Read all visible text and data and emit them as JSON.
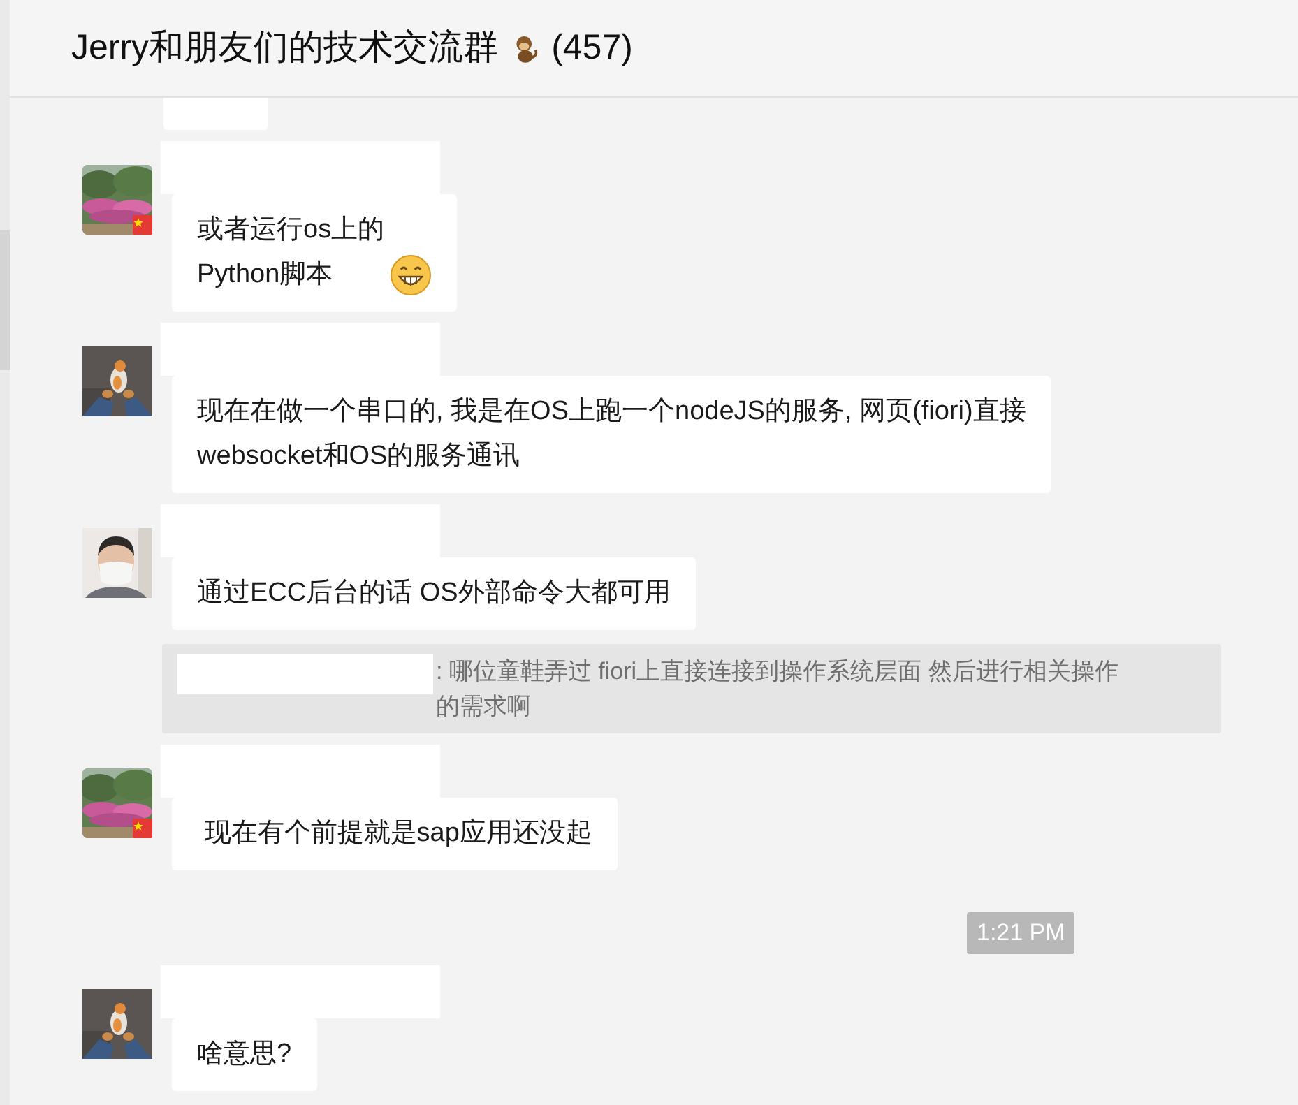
{
  "header": {
    "title": "Jerry和朋友们的技术交流群",
    "member_count": "(457)"
  },
  "items": [
    {
      "kind": "partial"
    },
    {
      "kind": "message",
      "flag": true,
      "lines": [
        "或者运行os上的",
        "Python脚本"
      ],
      "emoji": true
    },
    {
      "kind": "message",
      "flag": false,
      "lines": [
        "现在在做一个串口的, 我是在OS上跑一个nodeJS的服务, 网页(fiori)直接",
        "websocket和OS的服务通讯"
      ]
    },
    {
      "kind": "message",
      "flag": false,
      "lines": [
        "通过ECC后台的话 OS外部命令大都可用"
      ]
    },
    {
      "kind": "quote",
      "text": ": 哪位童鞋弄过 fiori上直接连接到操作系统层面 然后进行相关操作的需求啊"
    },
    {
      "kind": "message",
      "flag": true,
      "lines": [
        " 现在有个前提就是sap应用还没起"
      ]
    },
    {
      "kind": "time",
      "text": "1:21 PM"
    },
    {
      "kind": "message",
      "flag": false,
      "lines": [
        "啥意思?"
      ]
    }
  ]
}
